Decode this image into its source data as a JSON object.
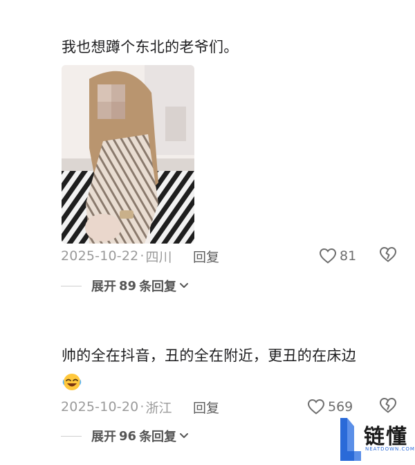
{
  "comments": [
    {
      "text": "我也想蹲个东北的老爷们。",
      "date": "2025-10-22",
      "location": "四川",
      "reply_label": "回复",
      "likes": "81",
      "expand_prefix": "展开",
      "expand_count": "89",
      "expand_suffix": "条回复",
      "has_photo": true
    },
    {
      "text": "帅的全在抖音，丑的全在附近，更丑的在床边",
      "emoji": "laughing-crying-emoji",
      "date": "2025-10-20",
      "location": "浙江",
      "reply_label": "回复",
      "likes": "569",
      "expand_prefix": "展开",
      "expand_count": "96",
      "expand_suffix": "条回复",
      "has_photo": false
    }
  ],
  "separator": "·",
  "watermark": {
    "text": "链懂",
    "sub": "NEATDOWN.COM"
  },
  "icons": {
    "like": "heart-outline-icon",
    "dislike": "broken-heart-icon",
    "expand": "chevron-down-icon"
  },
  "colors": {
    "meta": "#9a9a9a",
    "reply": "#5c5c5c",
    "watermark_accent": "#2a6ad8"
  }
}
